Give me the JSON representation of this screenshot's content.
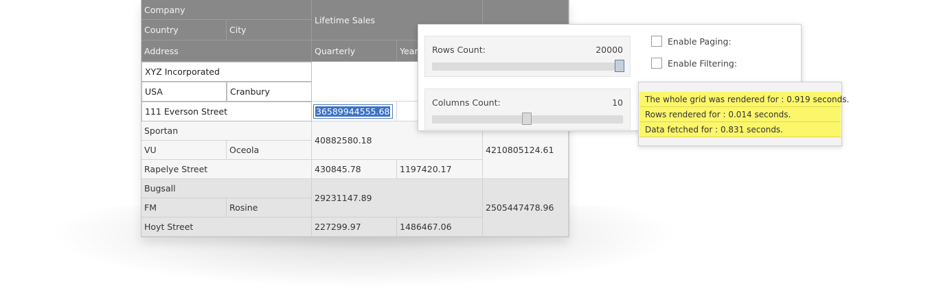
{
  "grid": {
    "headers": {
      "company": "Company",
      "country": "Country",
      "city": "City",
      "address": "Address",
      "lifetime_sales": "Lifetime Sales",
      "quarterly": "Quarterly",
      "yearly": "Year"
    },
    "rows": [
      {
        "company": "XYZ Incorporated",
        "country": "USA",
        "city": "Cranbury",
        "address": "111 Everson Street",
        "quarterly": "36589944555.68"
      },
      {
        "company": "Sportan",
        "country": "VU",
        "city": "Oceola",
        "address": "Rapelye Street",
        "lifetime_sales": "40882580.18",
        "quarterly": "430845.78",
        "yearly": "1197420.17",
        "total": "4210805124.61"
      },
      {
        "company": "Bugsall",
        "country": "FM",
        "city": "Rosine",
        "address": "Hoyt Street",
        "lifetime_sales": "29231147.89",
        "quarterly": "227299.97",
        "yearly": "1486467.06",
        "total": "2505447478.96"
      }
    ]
  },
  "settings": {
    "rows_count_label": "Rows Count:",
    "rows_count_value": "20000",
    "rows_slider_level": 1.0,
    "columns_count_label": "Columns Count:",
    "columns_count_value": "10",
    "columns_slider_level": 0.5,
    "enable_paging_label": "Enable Paging:",
    "enable_paging_checked": false,
    "enable_filtering_label": "Enable Filtering:",
    "enable_filtering_checked": false
  },
  "perf": {
    "line1": "The whole grid was rendered for : 0.919 seconds.",
    "line2": "Rows rendered for : 0.014 seconds.",
    "line3": "Data fetched for : 0.831 seconds.",
    "highlight_color": "#fbf66a"
  },
  "colors": {
    "header_bg": "#888888",
    "selection": "#3b72c4"
  }
}
